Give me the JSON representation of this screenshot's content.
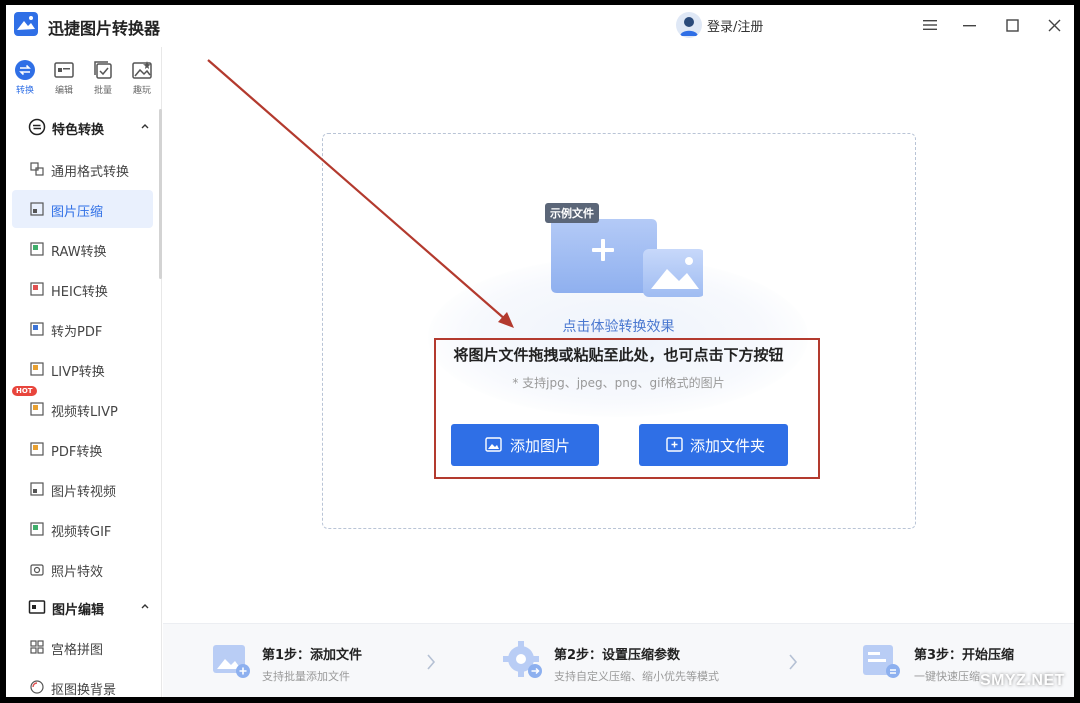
{
  "app": {
    "title": "迅捷图片转换器",
    "accent": "#2f6fe6"
  },
  "header": {
    "login_label": "登录/注册"
  },
  "rail": [
    {
      "id": "convert",
      "label": "转换",
      "icon": "convert-icon",
      "active": true
    },
    {
      "id": "edit",
      "label": "编辑",
      "icon": "edit-icon",
      "active": false
    },
    {
      "id": "batch",
      "label": "批量",
      "icon": "batch-icon",
      "active": false
    },
    {
      "id": "fun",
      "label": "趣玩",
      "icon": "fun-icon",
      "active": false
    }
  ],
  "sidebar": {
    "sections": [
      {
        "label": "特色转换",
        "icon": "special-convert-icon",
        "expanded": true
      },
      {
        "label": "图片编辑",
        "icon": "image-edit-icon",
        "expanded": true
      }
    ],
    "items": [
      {
        "label": "通用格式转换",
        "icon": "format-convert-icon",
        "active": false
      },
      {
        "label": "图片压缩",
        "icon": "compress-icon",
        "active": true
      },
      {
        "label": "RAW转换",
        "icon": "raw-icon",
        "active": false
      },
      {
        "label": "HEIC转换",
        "icon": "heic-icon",
        "active": false
      },
      {
        "label": "转为PDF",
        "icon": "pdf-icon",
        "active": false
      },
      {
        "label": "LIVP转换",
        "icon": "livp-icon",
        "active": false
      },
      {
        "label": "视频转LIVP",
        "icon": "video-livp-icon",
        "active": false
      },
      {
        "label": "PDF转换",
        "icon": "pdf-convert-icon",
        "active": false
      },
      {
        "label": "图片转视频",
        "icon": "image-video-icon",
        "active": false
      },
      {
        "label": "视频转GIF",
        "icon": "gif-icon",
        "active": false
      },
      {
        "label": "照片特效",
        "icon": "camera-icon",
        "active": false
      },
      {
        "label": "宫格拼图",
        "icon": "grid-icon",
        "active": false
      },
      {
        "label": "抠图换背景",
        "icon": "cutout-icon",
        "active": false
      }
    ],
    "hot_badge": "HOT"
  },
  "main": {
    "sample_tag": "示例文件",
    "sample_link": "点击体验转换效果",
    "drop_title": "将图片文件拖拽或粘贴至此处，也可点击下方按钮",
    "drop_sub": "* 支持jpg、jpeg、png、gif格式的图片",
    "add_image_label": "添加图片",
    "add_folder_label": "添加文件夹"
  },
  "steps": [
    {
      "title": "第1步：添加文件",
      "desc": "支持批量添加文件"
    },
    {
      "title": "第2步：设置压缩参数",
      "desc": "支持自定义压缩、缩小优先等模式"
    },
    {
      "title": "第3步：开始压缩",
      "desc": "一键快速压缩"
    }
  ],
  "watermark": "SMYZ.NET"
}
